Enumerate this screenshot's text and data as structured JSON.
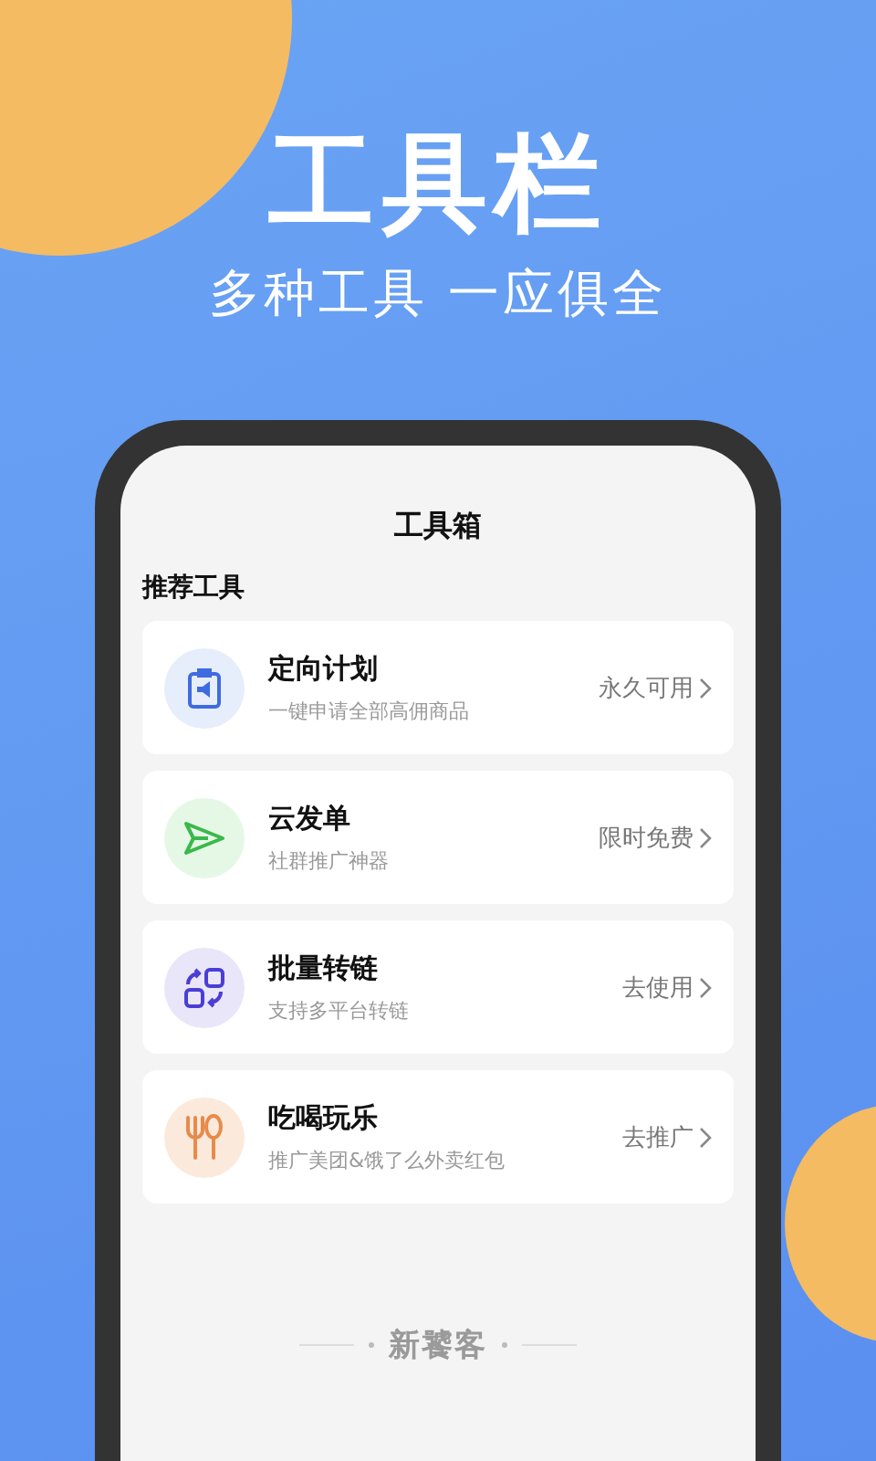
{
  "banner": {
    "title": "工具栏",
    "subtitle": "多种工具 一应俱全"
  },
  "screen": {
    "title": "工具箱",
    "section": "推荐工具",
    "tools": [
      {
        "kind": "clipboard",
        "color": "#e6edfb",
        "name": "定向计划",
        "desc": "一键申请全部高佣商品",
        "action": "永久可用"
      },
      {
        "kind": "send",
        "color": "#e5f8e6",
        "name": "云发单",
        "desc": "社群推广神器",
        "action": "限时免费"
      },
      {
        "kind": "convert",
        "color": "#e9e6fa",
        "name": "批量转链",
        "desc": "支持多平台转链",
        "action": "去使用"
      },
      {
        "kind": "utensils",
        "color": "#fbeadc",
        "name": "吃喝玩乐",
        "desc": "推广美团&饿了么外卖红包",
        "action": "去推广"
      }
    ],
    "footer": "新饕客"
  }
}
